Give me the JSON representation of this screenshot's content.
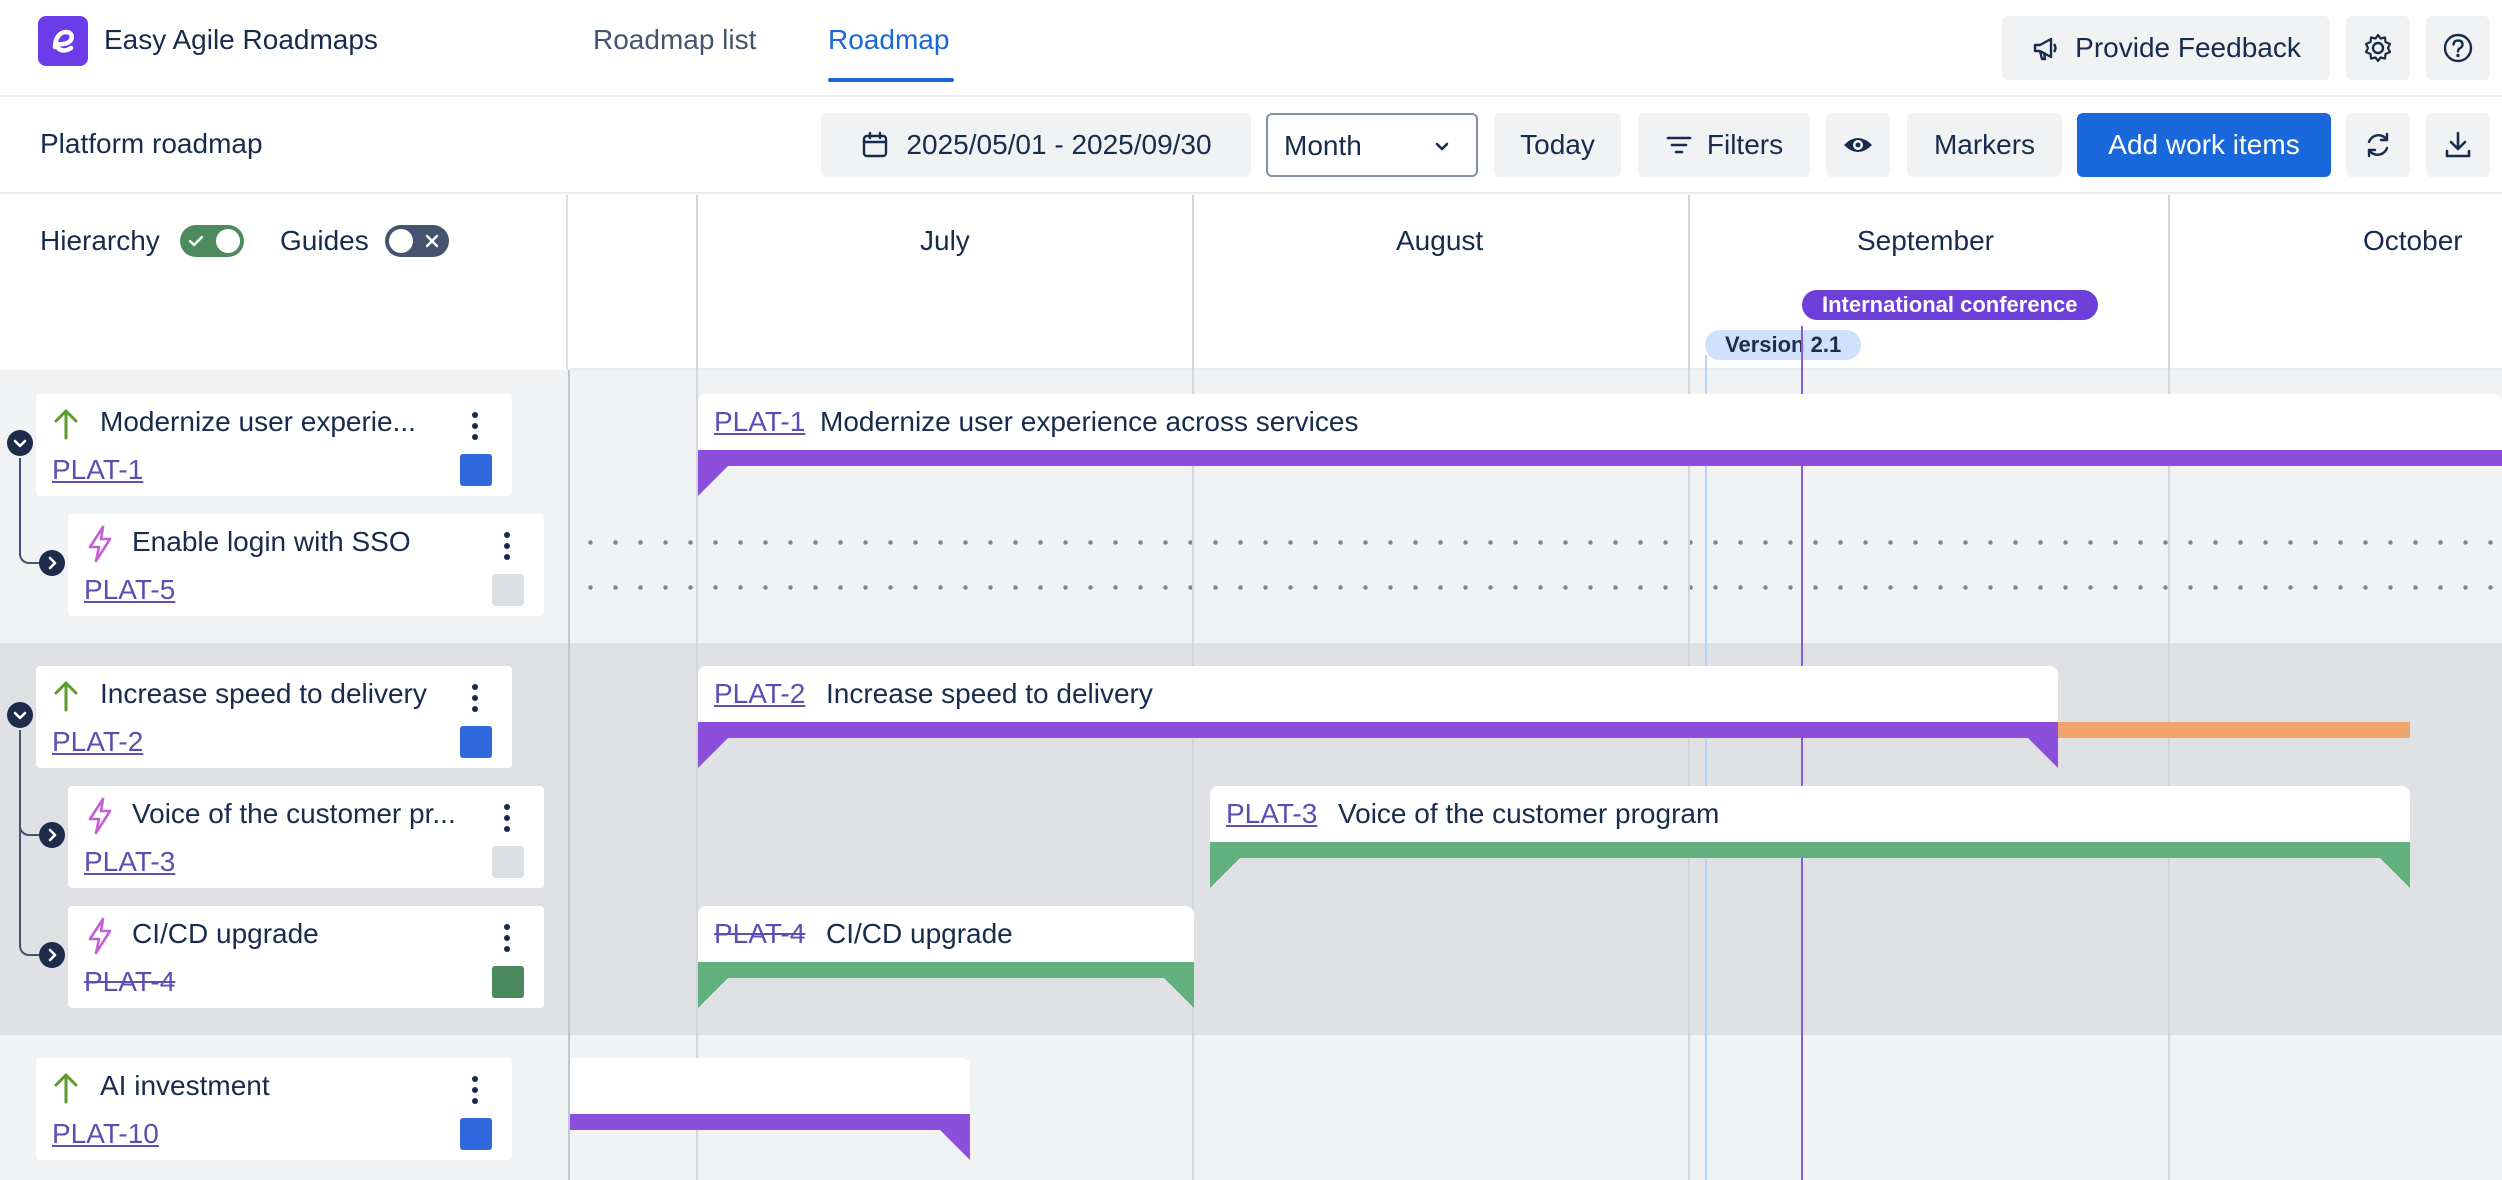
{
  "app": {
    "title": "Easy Agile Roadmaps"
  },
  "nav": {
    "tabs": [
      {
        "label": "Roadmap list"
      },
      {
        "label": "Roadmap"
      }
    ],
    "active_tab": "Roadmap"
  },
  "header_actions": {
    "feedback_label": "Provide Feedback"
  },
  "toolbar": {
    "roadmap_title": "Platform roadmap",
    "date_range": "2025/05/01 - 2025/09/30",
    "view_select": "Month",
    "today_label": "Today",
    "filters_label": "Filters",
    "markers_label": "Markers",
    "add_label": "Add work items"
  },
  "sidebar_header": {
    "hierarchy_label": "Hierarchy",
    "hierarchy_on": true,
    "guides_label": "Guides",
    "guides_on": false
  },
  "timeline": {
    "months": [
      "July",
      "August",
      "September",
      "October"
    ],
    "markers": [
      {
        "label": "International conference",
        "color": "#6e3ed8"
      },
      {
        "label": "Version 2.1",
        "color": "#cfe1fd"
      }
    ]
  },
  "items": [
    {
      "key": "PLAT-1",
      "title": "Modernize user experience across services",
      "sidebar_title": "Modernize user experie...",
      "type": "goal",
      "swatch": "#2f68dd",
      "bar_color": "#8b4fdb"
    },
    {
      "key": "PLAT-5",
      "title": "Enable login with SSO",
      "sidebar_title": "Enable login with SSO",
      "type": "epic",
      "swatch": "#dcdfe4"
    },
    {
      "key": "PLAT-2",
      "title": "Increase speed to delivery",
      "sidebar_title": "Increase speed to delivery",
      "type": "goal",
      "swatch": "#2f68dd",
      "bar_color": "#8b4fdb",
      "overrun_color": "#f0a36b"
    },
    {
      "key": "PLAT-3",
      "title": "Voice of the customer program",
      "sidebar_title": "Voice of the customer pr...",
      "type": "epic",
      "swatch": "#dcdfe4",
      "bar_color": "#63b07f"
    },
    {
      "key": "PLAT-4",
      "title": "CI/CD upgrade",
      "sidebar_title": "CI/CD upgrade",
      "type": "epic",
      "done": true,
      "swatch": "#4a8a5e",
      "bar_color": "#63b07f"
    },
    {
      "key": "PLAT-10",
      "title": "AI investment",
      "sidebar_title": "AI investment",
      "type": "goal",
      "swatch": "#2f68dd",
      "bar_color": "#8b4fdb"
    }
  ],
  "colors": {
    "accent": "#1868db",
    "brand": "#6c3ce9",
    "goal_icon": "#5b9a2c",
    "epic_icon": "#c061d6"
  }
}
